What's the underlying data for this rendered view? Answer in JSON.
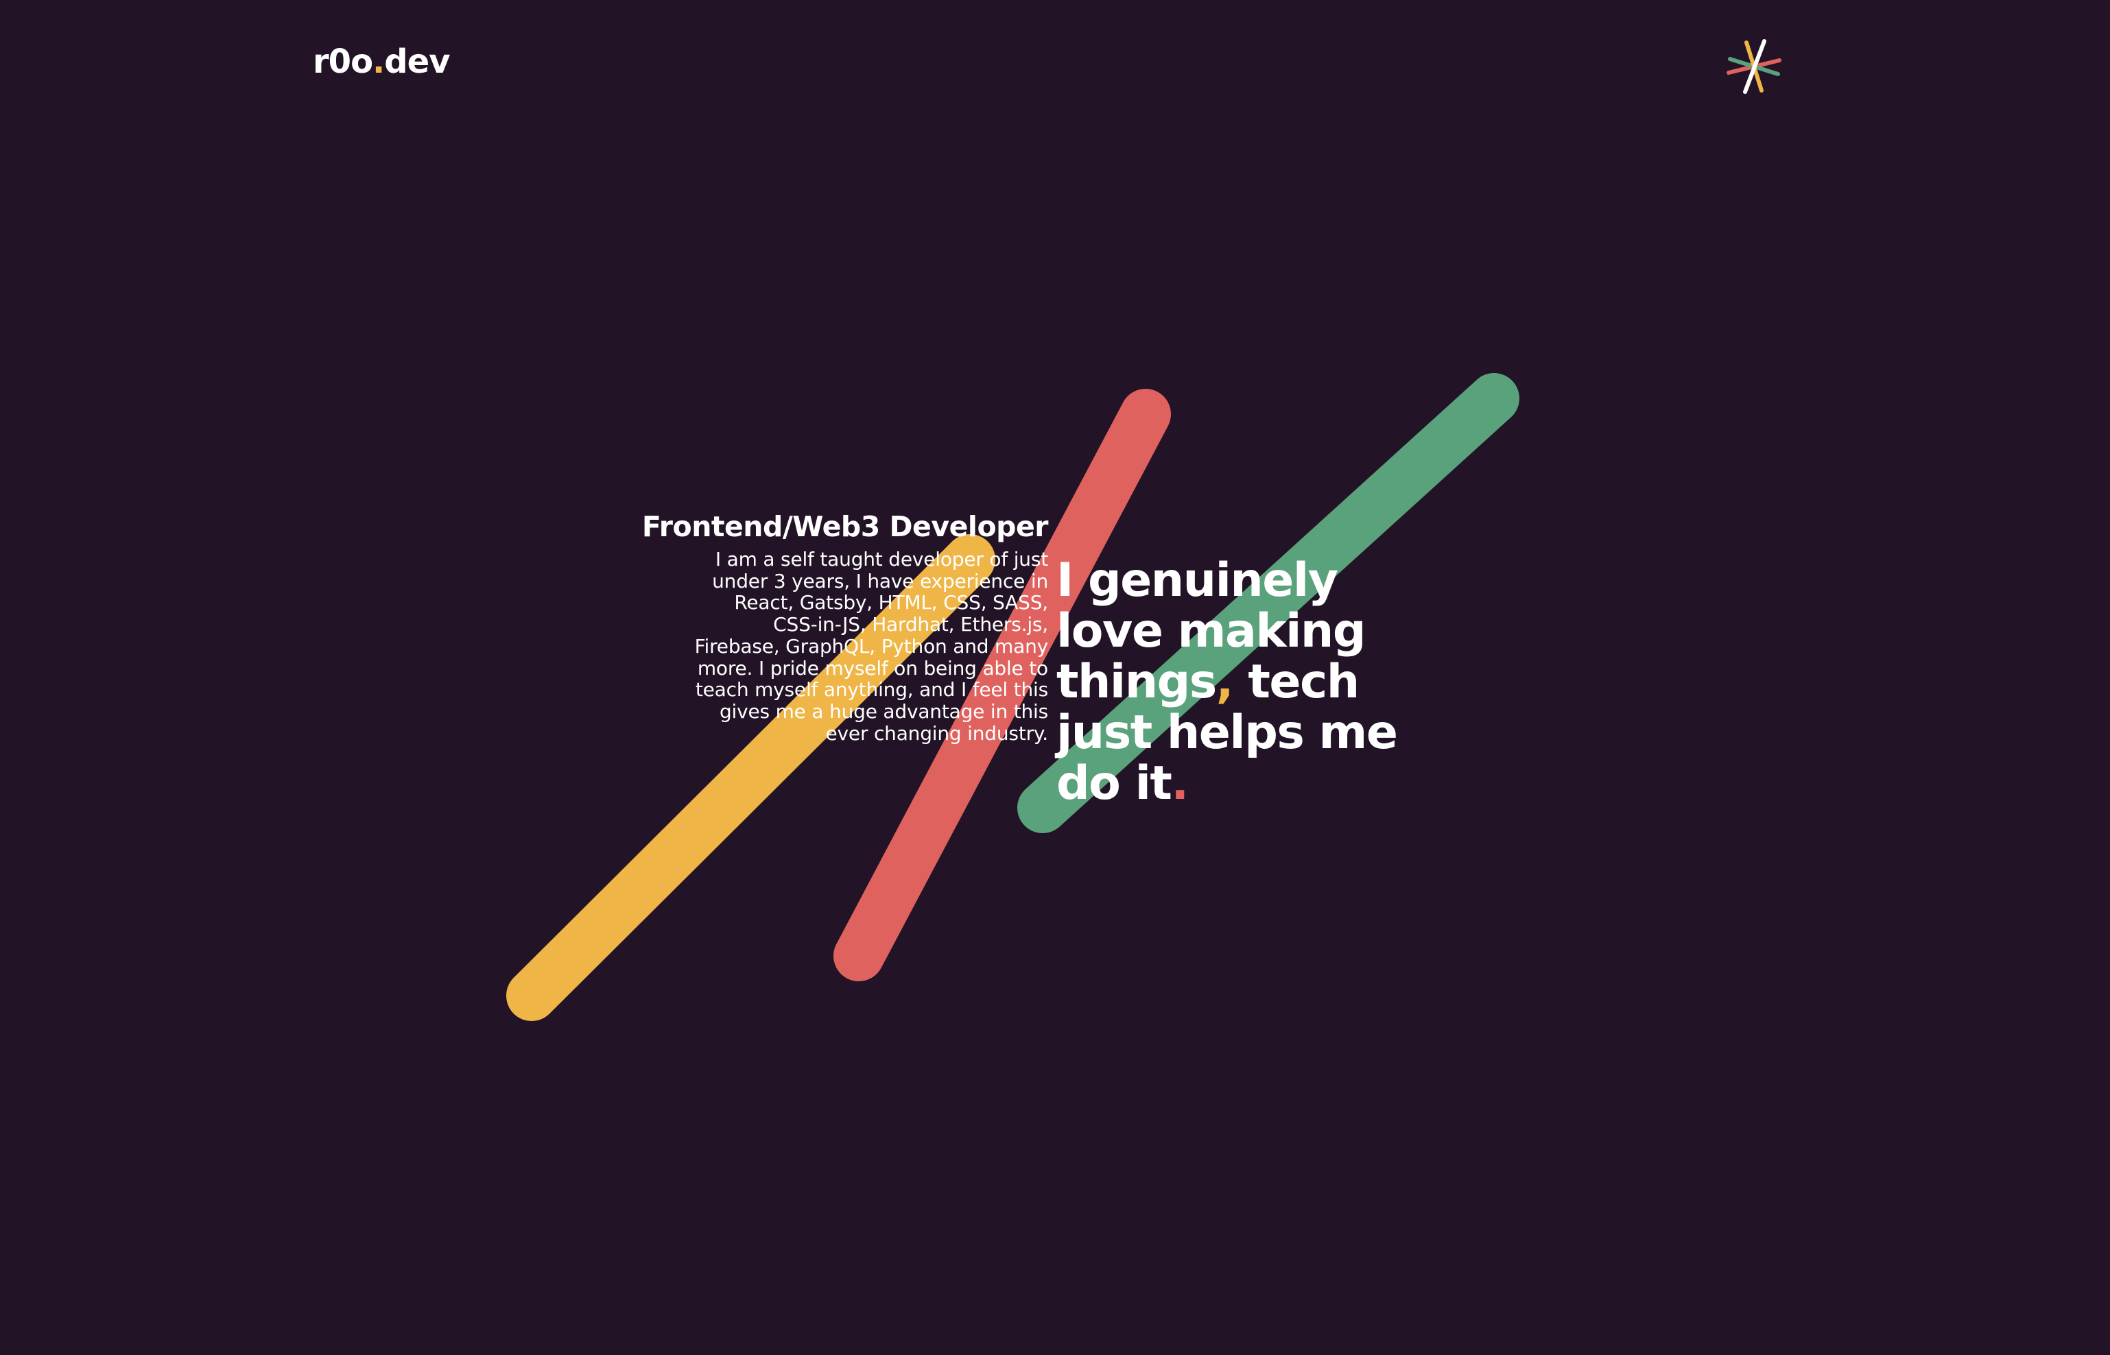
{
  "header": {
    "logo_main": "r0o",
    "logo_dot": ".",
    "logo_tail": "dev",
    "menu_icon": "asterisk-menu-icon"
  },
  "intro": {
    "role_title": "Frontend/Web3 Developer",
    "bio": "I am a self taught developer of just under 3 years, I have experience in React, Gatsby, HTML, CSS, SASS, CSS-in-JS, Hardhat, Ethers.js, Firebase, GraphQL, Python and many more. I pride myself on being able to teach myself anything, and I feel this gives me a huge advantage in this ever changing industry."
  },
  "tagline": {
    "line1": "I genuinely",
    "line2": "love making",
    "line3_a": "things",
    "line3_comma": ",",
    "line3_b": " tech",
    "line4": "just helps me",
    "line5": "do it",
    "line5_period": "."
  },
  "colors": {
    "background": "#221426",
    "yellow": "#f0b547",
    "red": "#e0625e",
    "green": "#5aa27b",
    "text": "#ffffff"
  }
}
